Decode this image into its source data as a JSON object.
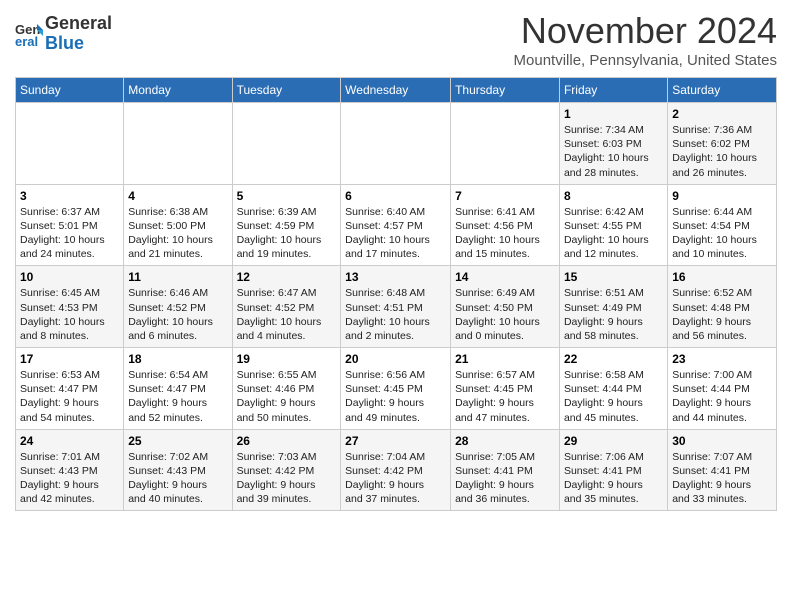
{
  "header": {
    "logo_line1": "General",
    "logo_line2": "Blue",
    "month": "November 2024",
    "location": "Mountville, Pennsylvania, United States"
  },
  "days_of_week": [
    "Sunday",
    "Monday",
    "Tuesday",
    "Wednesday",
    "Thursday",
    "Friday",
    "Saturday"
  ],
  "weeks": [
    [
      {
        "day": "",
        "info": ""
      },
      {
        "day": "",
        "info": ""
      },
      {
        "day": "",
        "info": ""
      },
      {
        "day": "",
        "info": ""
      },
      {
        "day": "",
        "info": ""
      },
      {
        "day": "1",
        "info": "Sunrise: 7:34 AM\nSunset: 6:03 PM\nDaylight: 10 hours\nand 28 minutes."
      },
      {
        "day": "2",
        "info": "Sunrise: 7:36 AM\nSunset: 6:02 PM\nDaylight: 10 hours\nand 26 minutes."
      }
    ],
    [
      {
        "day": "3",
        "info": "Sunrise: 6:37 AM\nSunset: 5:01 PM\nDaylight: 10 hours\nand 24 minutes."
      },
      {
        "day": "4",
        "info": "Sunrise: 6:38 AM\nSunset: 5:00 PM\nDaylight: 10 hours\nand 21 minutes."
      },
      {
        "day": "5",
        "info": "Sunrise: 6:39 AM\nSunset: 4:59 PM\nDaylight: 10 hours\nand 19 minutes."
      },
      {
        "day": "6",
        "info": "Sunrise: 6:40 AM\nSunset: 4:57 PM\nDaylight: 10 hours\nand 17 minutes."
      },
      {
        "day": "7",
        "info": "Sunrise: 6:41 AM\nSunset: 4:56 PM\nDaylight: 10 hours\nand 15 minutes."
      },
      {
        "day": "8",
        "info": "Sunrise: 6:42 AM\nSunset: 4:55 PM\nDaylight: 10 hours\nand 12 minutes."
      },
      {
        "day": "9",
        "info": "Sunrise: 6:44 AM\nSunset: 4:54 PM\nDaylight: 10 hours\nand 10 minutes."
      }
    ],
    [
      {
        "day": "10",
        "info": "Sunrise: 6:45 AM\nSunset: 4:53 PM\nDaylight: 10 hours\nand 8 minutes."
      },
      {
        "day": "11",
        "info": "Sunrise: 6:46 AM\nSunset: 4:52 PM\nDaylight: 10 hours\nand 6 minutes."
      },
      {
        "day": "12",
        "info": "Sunrise: 6:47 AM\nSunset: 4:52 PM\nDaylight: 10 hours\nand 4 minutes."
      },
      {
        "day": "13",
        "info": "Sunrise: 6:48 AM\nSunset: 4:51 PM\nDaylight: 10 hours\nand 2 minutes."
      },
      {
        "day": "14",
        "info": "Sunrise: 6:49 AM\nSunset: 4:50 PM\nDaylight: 10 hours\nand 0 minutes."
      },
      {
        "day": "15",
        "info": "Sunrise: 6:51 AM\nSunset: 4:49 PM\nDaylight: 9 hours\nand 58 minutes."
      },
      {
        "day": "16",
        "info": "Sunrise: 6:52 AM\nSunset: 4:48 PM\nDaylight: 9 hours\nand 56 minutes."
      }
    ],
    [
      {
        "day": "17",
        "info": "Sunrise: 6:53 AM\nSunset: 4:47 PM\nDaylight: 9 hours\nand 54 minutes."
      },
      {
        "day": "18",
        "info": "Sunrise: 6:54 AM\nSunset: 4:47 PM\nDaylight: 9 hours\nand 52 minutes."
      },
      {
        "day": "19",
        "info": "Sunrise: 6:55 AM\nSunset: 4:46 PM\nDaylight: 9 hours\nand 50 minutes."
      },
      {
        "day": "20",
        "info": "Sunrise: 6:56 AM\nSunset: 4:45 PM\nDaylight: 9 hours\nand 49 minutes."
      },
      {
        "day": "21",
        "info": "Sunrise: 6:57 AM\nSunset: 4:45 PM\nDaylight: 9 hours\nand 47 minutes."
      },
      {
        "day": "22",
        "info": "Sunrise: 6:58 AM\nSunset: 4:44 PM\nDaylight: 9 hours\nand 45 minutes."
      },
      {
        "day": "23",
        "info": "Sunrise: 7:00 AM\nSunset: 4:44 PM\nDaylight: 9 hours\nand 44 minutes."
      }
    ],
    [
      {
        "day": "24",
        "info": "Sunrise: 7:01 AM\nSunset: 4:43 PM\nDaylight: 9 hours\nand 42 minutes."
      },
      {
        "day": "25",
        "info": "Sunrise: 7:02 AM\nSunset: 4:43 PM\nDaylight: 9 hours\nand 40 minutes."
      },
      {
        "day": "26",
        "info": "Sunrise: 7:03 AM\nSunset: 4:42 PM\nDaylight: 9 hours\nand 39 minutes."
      },
      {
        "day": "27",
        "info": "Sunrise: 7:04 AM\nSunset: 4:42 PM\nDaylight: 9 hours\nand 37 minutes."
      },
      {
        "day": "28",
        "info": "Sunrise: 7:05 AM\nSunset: 4:41 PM\nDaylight: 9 hours\nand 36 minutes."
      },
      {
        "day": "29",
        "info": "Sunrise: 7:06 AM\nSunset: 4:41 PM\nDaylight: 9 hours\nand 35 minutes."
      },
      {
        "day": "30",
        "info": "Sunrise: 7:07 AM\nSunset: 4:41 PM\nDaylight: 9 hours\nand 33 minutes."
      }
    ]
  ]
}
